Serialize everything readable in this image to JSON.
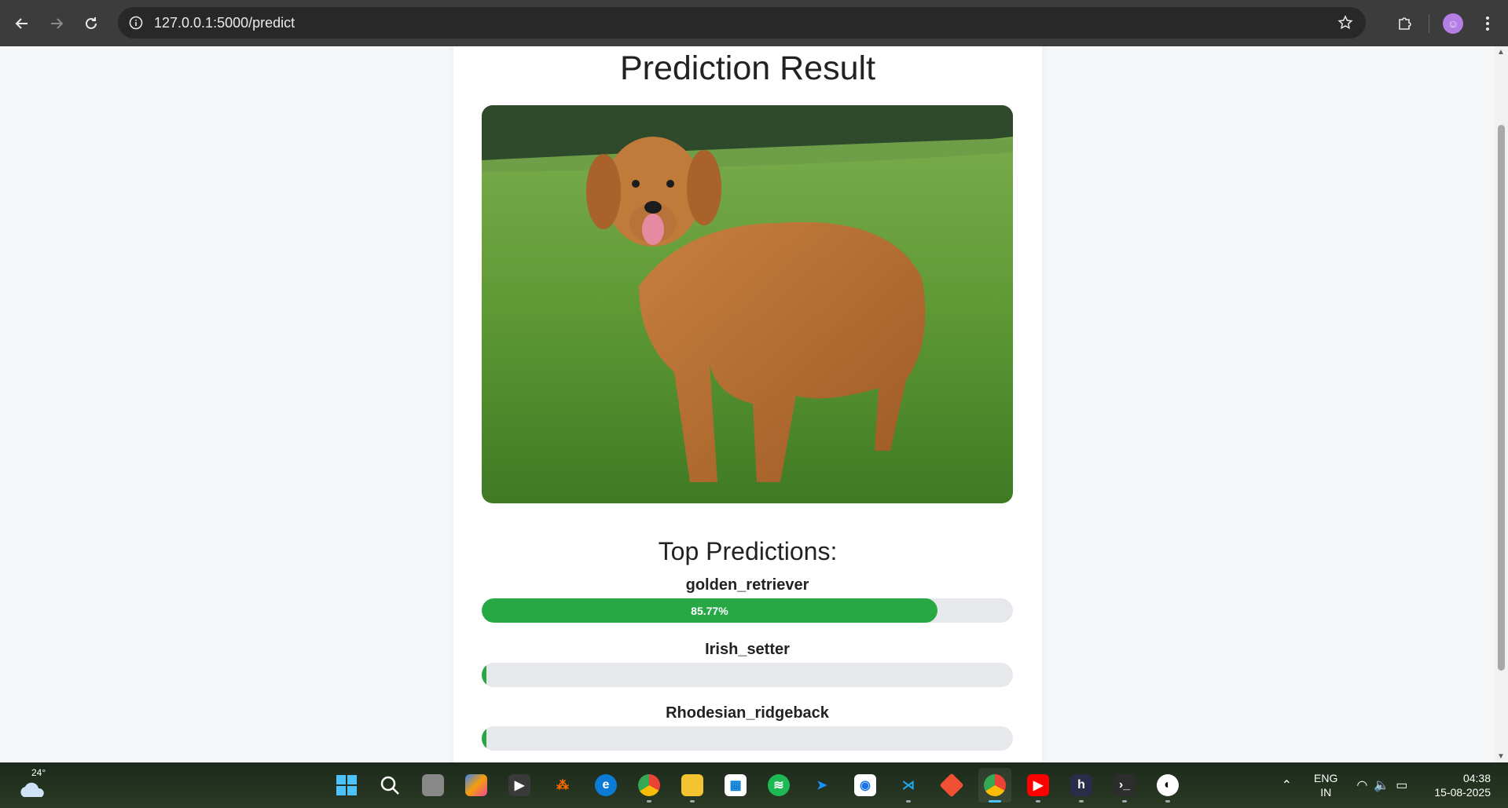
{
  "browser": {
    "url": "127.0.0.1:5000/predict",
    "back_icon": "arrow-left-icon",
    "forward_icon": "arrow-right-icon",
    "reload_icon": "reload-icon"
  },
  "page": {
    "title": "Prediction Result",
    "subtitle": "Top Predictions:",
    "predictions": [
      {
        "label": "golden_retriever",
        "percent": 85.77,
        "text": "85.77%"
      },
      {
        "label": "Irish_setter",
        "percent": 0.3,
        "text": ""
      },
      {
        "label": "Rhodesian_ridgeback",
        "percent": 0.3,
        "text": ""
      }
    ],
    "bar_color": "#28a745"
  },
  "taskbar": {
    "temperature": "24°",
    "lang_line1": "ENG",
    "lang_line2": "IN",
    "time": "04:38",
    "date": "15-08-2025",
    "apps": [
      "windows-start-icon",
      "search-icon",
      "task-view-icon",
      "copilot-icon",
      "media-icon",
      "app-icon",
      "edge-icon",
      "chrome-icon",
      "file-explorer-icon",
      "store-icon",
      "spotify-icon",
      "app-icon",
      "app-icon",
      "vscode-icon",
      "git-icon",
      "chrome-icon",
      "youtube-icon",
      "hackerrank-icon",
      "terminal-icon",
      "github-icon"
    ]
  }
}
